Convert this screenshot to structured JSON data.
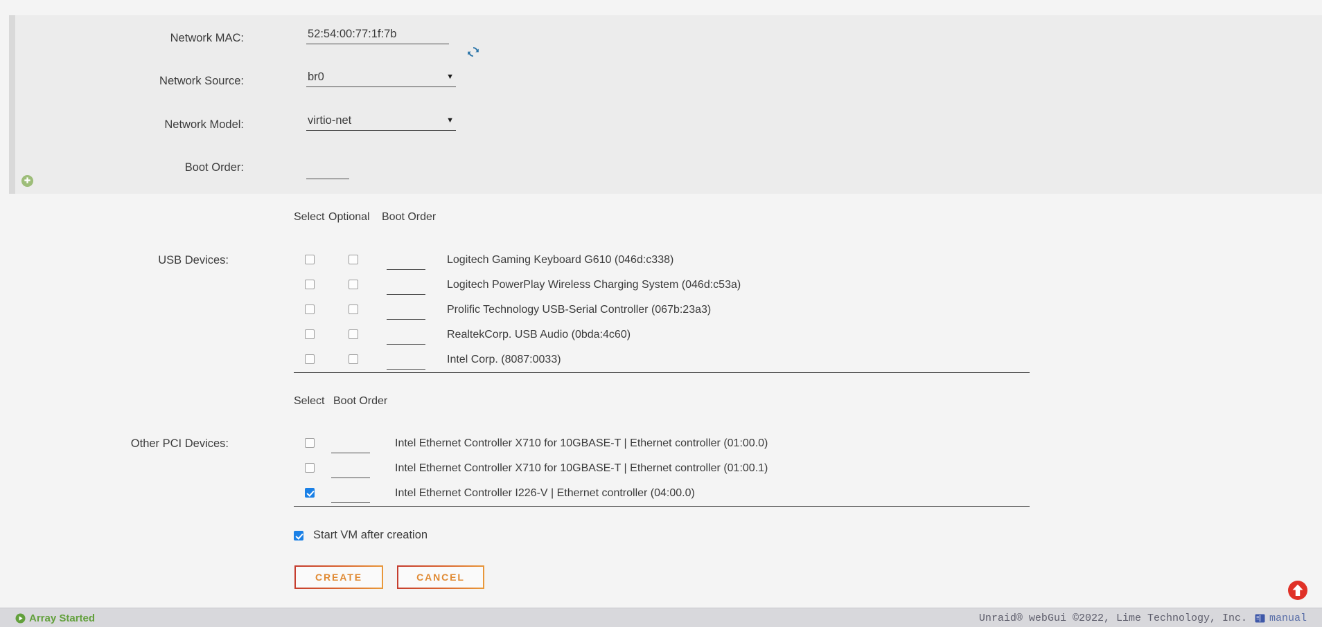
{
  "form": {
    "fields": [
      {
        "label": "Network MAC:",
        "type": "text",
        "value": "52:54:00:77:1f:7b"
      },
      {
        "label": "Network Source:",
        "type": "select",
        "value": "br0"
      },
      {
        "label": "Network Model:",
        "type": "select",
        "value": "virtio-net"
      },
      {
        "label": "Boot Order:",
        "type": "text",
        "value": ""
      }
    ],
    "refresh_icon": "refresh-icon",
    "add_icon": "plus-circle-icon"
  },
  "usb_section": {
    "label": "USB Devices:",
    "columns": [
      "Select",
      "Optional",
      "Boot Order"
    ],
    "rows": [
      {
        "selected": false,
        "optional": false,
        "boot_order": "",
        "name": "Logitech Gaming Keyboard G610 (046d:c338)"
      },
      {
        "selected": false,
        "optional": false,
        "boot_order": "",
        "name": "Logitech PowerPlay Wireless Charging System (046d:c53a)"
      },
      {
        "selected": false,
        "optional": false,
        "boot_order": "",
        "name": "Prolific Technology USB-Serial Controller (067b:23a3)"
      },
      {
        "selected": false,
        "optional": false,
        "boot_order": "",
        "name": "RealtekCorp. USB Audio (0bda:4c60)"
      },
      {
        "selected": false,
        "optional": false,
        "boot_order": "",
        "name": "Intel Corp. (8087:0033)"
      }
    ]
  },
  "pci_section": {
    "label": "Other PCI Devices:",
    "columns": [
      "Select",
      "Boot Order"
    ],
    "rows": [
      {
        "selected": false,
        "boot_order": "",
        "name": "Intel Ethernet Controller X710 for 10GBASE-T | Ethernet controller (01:00.0)"
      },
      {
        "selected": false,
        "boot_order": "",
        "name": "Intel Ethernet Controller X710 for 10GBASE-T | Ethernet controller (01:00.1)"
      },
      {
        "selected": true,
        "boot_order": "",
        "name": "Intel Ethernet Controller I226-V | Ethernet controller (04:00.0)"
      }
    ]
  },
  "start_vm": {
    "label": "Start VM after creation",
    "checked": true
  },
  "buttons": {
    "create": "CREATE",
    "cancel": "CANCEL"
  },
  "scroll_top": {
    "icon": "arrow-up-circle-icon"
  },
  "footer": {
    "array_status": "Array Started",
    "copyright": "Unraid® webGui ©2022, Lime Technology, Inc.",
    "manual_label": "manual",
    "manual_icon": "book-icon"
  },
  "colors": {
    "accent_blue": "#1a80e6",
    "status_green": "#62a03c",
    "button_orange": "#e08a33",
    "button_red": "#c43b2e",
    "scroll_top_red": "#e03127",
    "link_blue": "#5a6fa8"
  }
}
